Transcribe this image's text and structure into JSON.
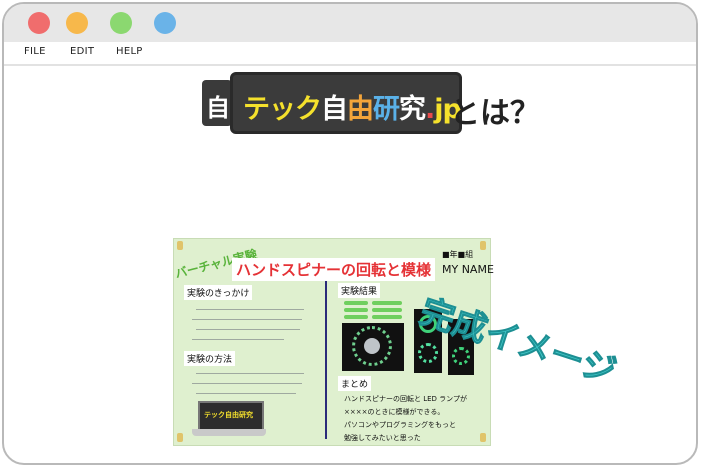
{
  "window": {
    "traffic_lights": [
      "#f06d6d",
      "#f7b84b",
      "#8bd870",
      "#6ab3e8"
    ]
  },
  "menu": {
    "items": [
      "FILE",
      "EDIT",
      "HELP"
    ]
  },
  "heading": {
    "logo_prefix": "自",
    "logo_parts": [
      {
        "text": "テック",
        "color": "#f5e12c"
      },
      {
        "text": "自",
        "color": "#ffffff"
      },
      {
        "text": "由",
        "color": "#f3a43a"
      },
      {
        "text": "研",
        "color": "#5ab1e8"
      },
      {
        "text": "究",
        "color": "#ffffff"
      },
      {
        "text": ".",
        "color": "#e94b4b"
      },
      {
        "text": "jp",
        "color": "#f5e12c"
      }
    ],
    "suffix": "とは？"
  },
  "poster": {
    "partial_label": "バーチャル実験",
    "title": "ハンドスピナーの回転と模様",
    "grade_text": "■年■組",
    "name": "MY NAME",
    "section_motivation": "実験のきっかけ",
    "section_method": "実験の方法",
    "section_results": "実験結果",
    "section_summary": "まとめ",
    "laptop_logo": "テック自由研究",
    "summary_lines": [
      "ハンドスピナーの回転と LED ランプが",
      "××××のときに模様ができる。",
      "パソコンやプログラミングをもっと",
      "勉強してみたいと思った"
    ]
  },
  "stamp": {
    "text": "完成イメージ"
  }
}
